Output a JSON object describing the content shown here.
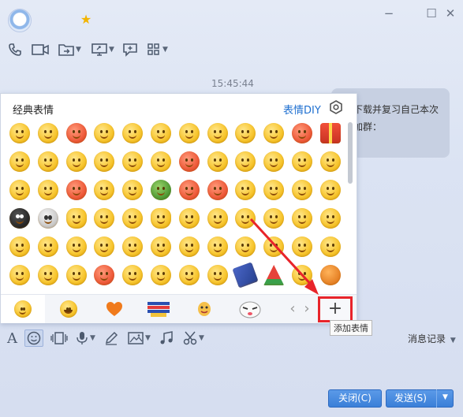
{
  "chat": {
    "timestamp": "15:45:44",
    "message_line1": "下载并复习自己本次",
    "message_line2": "加群："
  },
  "emoji_panel": {
    "title": "经典表情",
    "diy_label": "表情DIY",
    "add_button_label": "+",
    "add_tooltip": "添加表情",
    "prev_arrow": "‹",
    "next_arrow": "›"
  },
  "bottom_toolbar": {
    "history_label": "消息记录",
    "font_label": "A"
  },
  "buttons": {
    "close_label": "关闭(C)",
    "send_label": "发送(S)"
  },
  "colors": {
    "accent_blue": "#1e6fd0",
    "highlight_red": "#e8242a",
    "send_button": "#3a7fd8"
  }
}
